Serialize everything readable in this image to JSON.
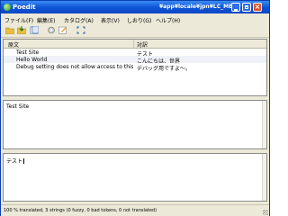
{
  "window": {
    "app_name": "Poedit",
    "path": "¥app¥locale¥jpn¥LC_ME..."
  },
  "menu": [
    "ファイル(F)",
    "編集(E)",
    "カタログ(A)",
    "表示(V)",
    "しおり(G)",
    "ヘルプ(H)"
  ],
  "list": {
    "columns": {
      "source": "原文",
      "translation": "対訳"
    },
    "rows": [
      {
        "source": "Test Site",
        "translation": "テスト"
      },
      {
        "source": "Hello World",
        "translation": "こんにちは、世界"
      },
      {
        "source": "Debug setting does not allow access to this url.",
        "translation": "デバッグ用ですよ～。"
      }
    ]
  },
  "source_pane": {
    "text": "Test Site"
  },
  "translation_pane": {
    "text": "テスト"
  },
  "status": {
    "text": "100 % translated, 3 strings (0 fuzzy, 0 bad tokens, 0 not translated)"
  },
  "colors": {
    "title_bar": "#0f55d8",
    "selected_row": "#eef2f8"
  }
}
